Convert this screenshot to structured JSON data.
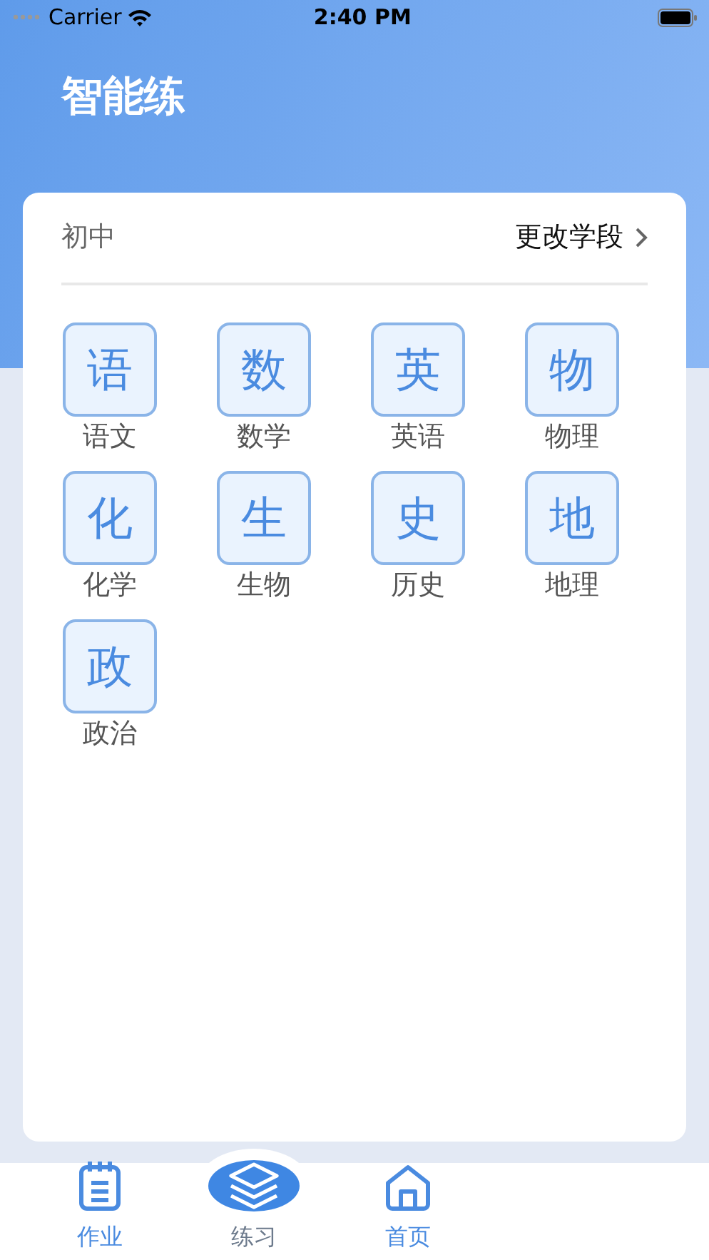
{
  "status_bar": {
    "carrier": "Carrier",
    "time": "2:40 PM"
  },
  "title": "智能练",
  "stage": {
    "current": "初中",
    "change_link": "更改学段"
  },
  "subjects": [
    {
      "glyph": "语",
      "label": "语文"
    },
    {
      "glyph": "数",
      "label": "数学"
    },
    {
      "glyph": "英",
      "label": "英语"
    },
    {
      "glyph": "物",
      "label": "物理"
    },
    {
      "glyph": "化",
      "label": "化学"
    },
    {
      "glyph": "生",
      "label": "生物"
    },
    {
      "glyph": "史",
      "label": "历史"
    },
    {
      "glyph": "地",
      "label": "地理"
    },
    {
      "glyph": "政",
      "label": "政治"
    }
  ],
  "tabs": [
    {
      "kind": "notebook",
      "label": "作业",
      "selected": false
    },
    {
      "kind": "layers",
      "label": "练习",
      "selected": true
    },
    {
      "kind": "home",
      "label": "首页",
      "selected": false
    }
  ]
}
